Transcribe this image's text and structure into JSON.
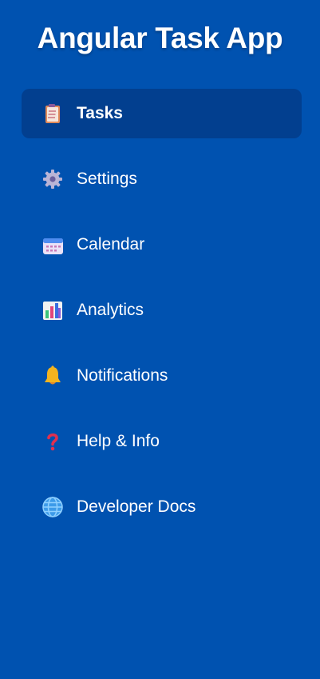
{
  "app": {
    "title": "Angular Task App"
  },
  "sidebar": {
    "items": [
      {
        "label": "Tasks",
        "icon": "clipboard-icon",
        "active": true
      },
      {
        "label": "Settings",
        "icon": "gear-icon",
        "active": false
      },
      {
        "label": "Calendar",
        "icon": "calendar-icon",
        "active": false
      },
      {
        "label": "Analytics",
        "icon": "chart-icon",
        "active": false
      },
      {
        "label": "Notifications",
        "icon": "bell-icon",
        "active": false
      },
      {
        "label": "Help & Info",
        "icon": "question-icon",
        "active": false
      },
      {
        "label": "Developer Docs",
        "icon": "globe-icon",
        "active": false
      }
    ]
  },
  "colors": {
    "background": "#0052b0",
    "active_item": "#023f8f",
    "text": "#ffffff"
  }
}
